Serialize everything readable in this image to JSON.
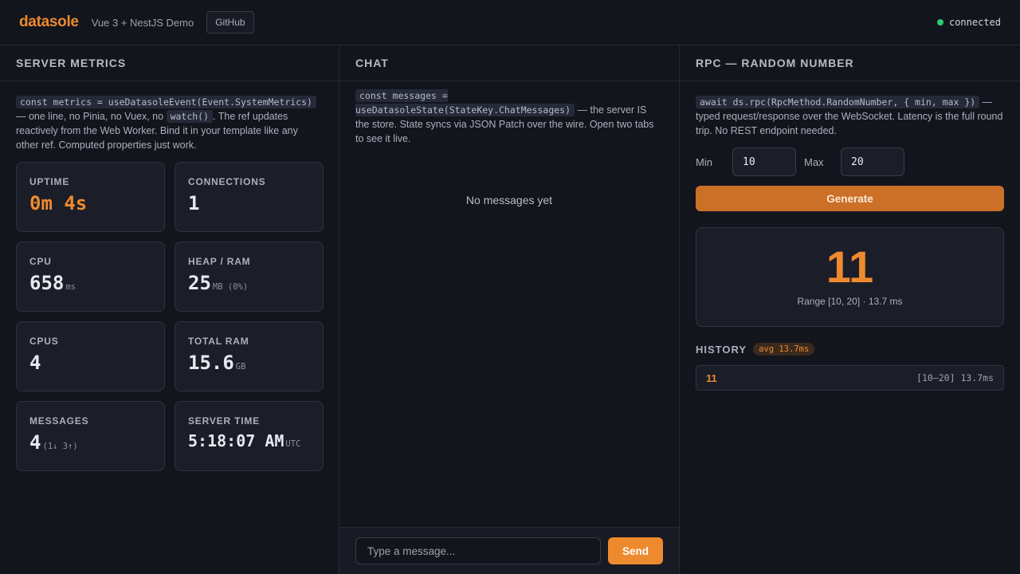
{
  "header": {
    "brand": "datasole",
    "subtitle": "Vue 3 + NestJS Demo",
    "github_label": "GitHub",
    "status_text": "connected",
    "status_color": "#2ecc71"
  },
  "metrics": {
    "title": "SERVER METRICS",
    "desc_code": "const metrics = useDatasoleEvent(Event.SystemMetrics)",
    "desc_text1": " — one line, no Pinia, no Vuex, no ",
    "desc_code2": "watch()",
    "desc_text2": ". The ref updates reactively from the Web Worker. Bind it in your template like any other ref. Computed properties just work.",
    "cards": [
      {
        "label": "UPTIME",
        "value": "0m 4s",
        "unit": ""
      },
      {
        "label": "CONNECTIONS",
        "value": "1",
        "unit": ""
      },
      {
        "label": "CPU",
        "value": "658",
        "unit": "ms"
      },
      {
        "label": "HEAP / RAM",
        "value": "25",
        "unit": "MB (0%)"
      },
      {
        "label": "CPUS",
        "value": "4",
        "unit": ""
      },
      {
        "label": "TOTAL RAM",
        "value": "15.6",
        "unit": "GB"
      },
      {
        "label": "MESSAGES",
        "value": "4",
        "unit": "(1↓ 3↑)"
      },
      {
        "label": "SERVER TIME",
        "value": "5:18:07 AM",
        "unit": "UTC"
      }
    ]
  },
  "chat": {
    "title": "CHAT",
    "desc_code": "const messages = useDatasoleState(StateKey.ChatMessages)",
    "desc_text": " — the server IS the store. State syncs via JSON Patch over the wire. Open two tabs to see it live.",
    "empty_text": "No messages yet",
    "input_placeholder": "Type a message...",
    "send_label": "Send"
  },
  "rpc": {
    "title": "RPC — RANDOM NUMBER",
    "desc_code": "await ds.rpc(RpcMethod.RandomNumber, { min, max })",
    "desc_text": " — typed request/response over the WebSocket. Latency is the full round trip. No REST endpoint needed.",
    "min_label": "Min",
    "min_value": "10",
    "max_label": "Max",
    "max_value": "20",
    "generate_label": "Generate",
    "result_value": "11",
    "result_meta": "Range [10, 20] · 13.7 ms",
    "history_title": "HISTORY",
    "history_avg": "avg 13.7ms",
    "history": [
      {
        "value": "11",
        "meta": "[10–20] 13.7ms"
      }
    ]
  }
}
